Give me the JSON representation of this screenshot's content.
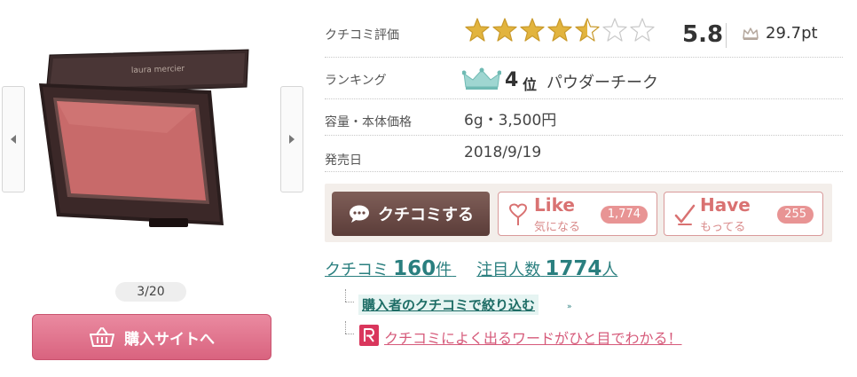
{
  "gallery": {
    "counter": "3/20",
    "brand_text": "laura mercier",
    "buy_label": "購入サイトへ"
  },
  "rating": {
    "label": "クチコミ評価",
    "stars_value": 4.5,
    "stars_max": 7,
    "score": "5.8",
    "points": "29.7pt"
  },
  "ranking": {
    "label": "ランキング",
    "number": "4",
    "unit": "位",
    "category": "パウダーチーク"
  },
  "capacity": {
    "label": "容量・本体価格",
    "value": "6g・3,500円"
  },
  "release": {
    "label": "発売日",
    "value": "2018/9/19"
  },
  "actions": {
    "review_label": "クチコミする",
    "like_main": "Like",
    "like_sub": "気になる",
    "like_count": "1,774",
    "have_main": "Have",
    "have_sub": "もってる",
    "have_count": "255"
  },
  "stats": {
    "reviews_label": "クチコミ",
    "reviews_count": "160",
    "reviews_unit": "件",
    "watchers_label": "注目人数",
    "watchers_count": "1774",
    "watchers_unit": "人"
  },
  "links": {
    "filter": "購入者のクチコミで絞り込む",
    "filter_arrows": "»",
    "words": "クチコミによく出るワードがひと目でわかる！"
  },
  "colors": {
    "accent_pink": "#d9637f",
    "link_teal": "#2a7f7f",
    "review_brown": "#5b3d39",
    "star_gold": "#e2b43e"
  }
}
